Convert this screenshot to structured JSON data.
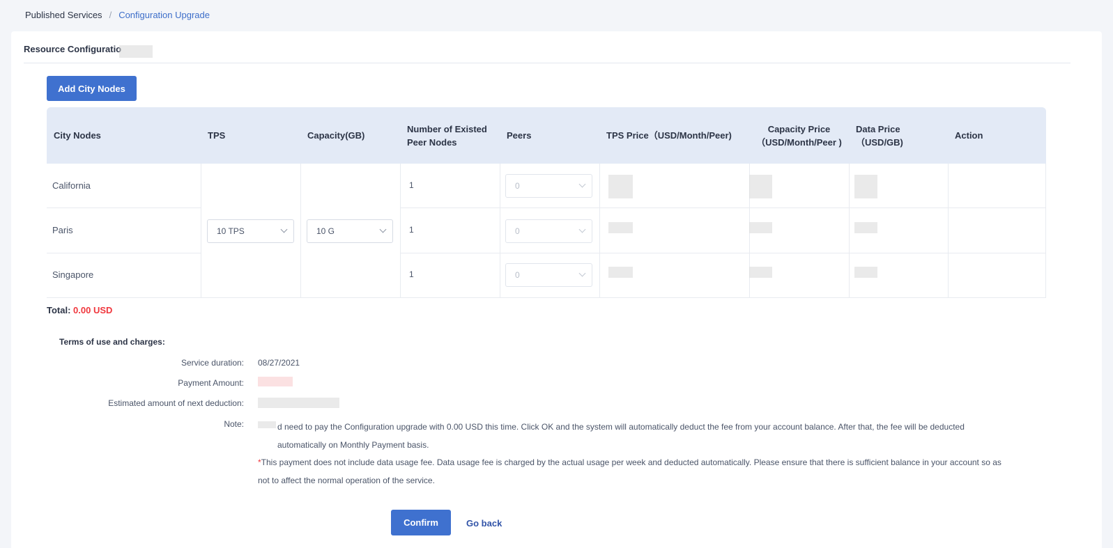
{
  "breadcrumb": {
    "root": "Published Services",
    "separator": "/",
    "current": "Configuration Upgrade"
  },
  "section": {
    "title": "Resource Configuratio"
  },
  "add_button_label": "Add City Nodes",
  "table": {
    "headers": [
      "City Nodes",
      "TPS",
      "Capacity(GB)",
      "Number of Existed Peer Nodes",
      "Peers",
      "TPS Price（USD/Month/Peer)",
      "Capacity Price （USD/Month/Peer )",
      "Data Price （USD/GB)",
      "Action"
    ],
    "rows": [
      {
        "city": "California",
        "existed": "1",
        "peers": "0"
      },
      {
        "city": "Paris",
        "existed": "1",
        "peers": "0"
      },
      {
        "city": "Singapore",
        "existed": "1",
        "peers": "0"
      }
    ],
    "tps_value": "10 TPS",
    "capacity_value": "10 G"
  },
  "total": {
    "label": "Total:",
    "value": "0.00 USD"
  },
  "terms": {
    "title": "Terms of use and charges:",
    "service_duration_label": "Service duration:",
    "service_duration_value": "08/27/2021",
    "payment_amount_label": "Payment Amount:",
    "next_deduction_label": "Estimated amount of next deduction:",
    "note_label": "Note:",
    "note_text": "d need to pay the Configuration upgrade with 0.00 USD this time. Click OK and the system will automatically deduct the fee from your account balance. After that, the fee will be deducted automatically on Monthly Payment basis.",
    "note_asterisk": "*",
    "note_warning": "This payment does not include data usage fee. Data usage fee is charged by the actual usage per week and deducted automatically. Please ensure that there is sufficient balance in your account so as not to affect the normal operation of the service."
  },
  "buttons": {
    "confirm": "Confirm",
    "go_back": "Go back"
  },
  "colors": {
    "primary": "#3f71cf",
    "accent_red": "#f0373d",
    "header_bg": "#e3eaf6",
    "link": "#3254a8"
  }
}
